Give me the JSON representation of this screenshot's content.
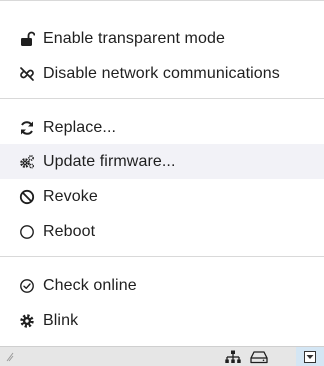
{
  "menu": {
    "items": [
      {
        "label": "Enable transparent mode",
        "icon": "unlock-icon"
      },
      {
        "label": "Disable network communications",
        "icon": "unlink-icon"
      },
      {
        "label": "Replace...",
        "icon": "refresh-icon"
      },
      {
        "label": "Update firmware...",
        "icon": "gears-icon"
      },
      {
        "label": "Revoke",
        "icon": "ban-icon"
      },
      {
        "label": "Reboot",
        "icon": "circle-icon"
      },
      {
        "label": "Check online",
        "icon": "check-circle-icon"
      },
      {
        "label": "Blink",
        "icon": "gear-icon"
      }
    ],
    "highlighted_item": "Update firmware..."
  },
  "statusbar": {
    "icons": [
      "network-icon",
      "hard-drive-icon",
      "dropdown-toggle-icon"
    ]
  },
  "colors": {
    "hover_background": "#f2f2f7",
    "statusbar_background": "#e6e6e6",
    "dropdown_background": "#d4e6f4"
  }
}
